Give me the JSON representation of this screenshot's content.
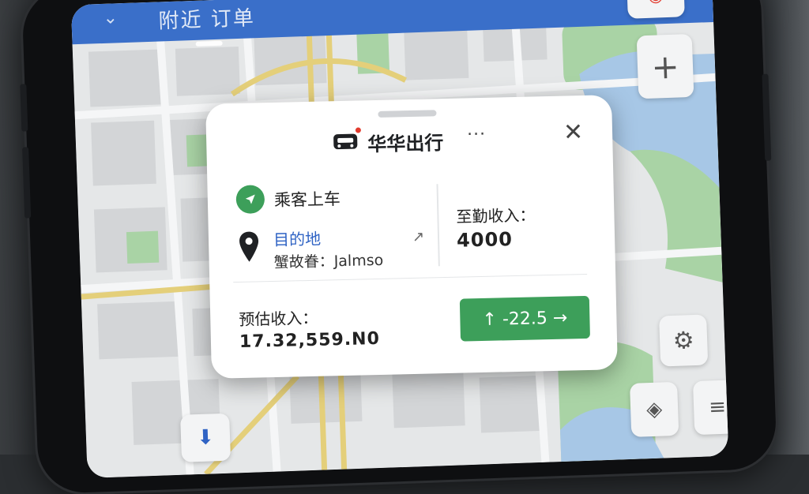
{
  "topbar": {
    "text": "附近 订单"
  },
  "card": {
    "brand": "华华出行",
    "more_label": "···",
    "close_label": "✕",
    "pickup_label": "乘客上车",
    "destination_label": "目的地",
    "destination_address": "蟹故眷：Jalmso",
    "arrow_label": "↗",
    "side_label": "至勤收入：",
    "side_value": "4000",
    "estimate_label": "预估收入：",
    "estimate_value": "17.32,559.N0",
    "action_button_label": "↑  -22.5 →"
  },
  "colors": {
    "accent_green": "#3d9f5a",
    "topbar_blue": "#3a6fc9",
    "link_blue": "#2f63c4",
    "alert_red": "#e23b2e"
  },
  "icons": [
    "car-icon",
    "navigation-arrow-icon",
    "location-pin-icon",
    "close-icon",
    "zoom-in-icon",
    "compass-icon",
    "settings-gear-icon",
    "recenter-icon",
    "menu-icon",
    "download-icon"
  ]
}
